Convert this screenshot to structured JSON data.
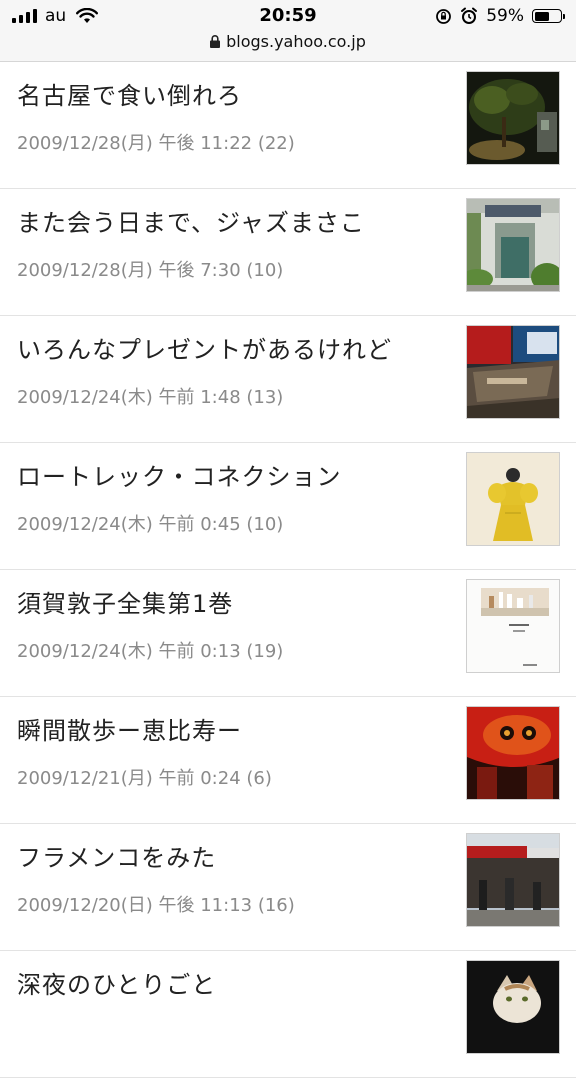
{
  "status_bar": {
    "carrier": "au",
    "time": "20:59",
    "battery_percent": "59%",
    "battery_level": 0.59
  },
  "browser": {
    "url": "blogs.yahoo.co.jp"
  },
  "articles": [
    {
      "title": "名古屋で食い倒れろ",
      "meta": "2009/12/28(月) 午後 11:22 (22)",
      "thumb_icon": "garden-at-night-photo"
    },
    {
      "title": "また会う日まで、ジャズまさこ",
      "meta": "2009/12/28(月) 午後 7:30 (10)",
      "thumb_icon": "cafe-storefront-photo"
    },
    {
      "title": "いろんなプレゼントがあるけれど",
      "meta": "2009/12/24(木) 午前 1:48 (13)",
      "thumb_icon": "books-photo"
    },
    {
      "title": "ロートレック・コネクション",
      "meta": "2009/12/24(木) 午前 0:45 (10)",
      "thumb_icon": "yellow-dress-poster"
    },
    {
      "title": "須賀敦子全集第1巻",
      "meta": "2009/12/24(木) 午前 0:13 (19)",
      "thumb_icon": "book-cover"
    },
    {
      "title": "瞬間散歩ー恵比寿ー",
      "meta": "2009/12/21(月) 午前 0:24 (6)",
      "thumb_icon": "red-lantern-photo"
    },
    {
      "title": "フラメンコをみた",
      "meta": "2009/12/20(日) 午後 11:13 (16)",
      "thumb_icon": "street-scene-photo"
    },
    {
      "title": "深夜のひとりごと",
      "meta": "",
      "thumb_icon": "cat-photo"
    }
  ]
}
